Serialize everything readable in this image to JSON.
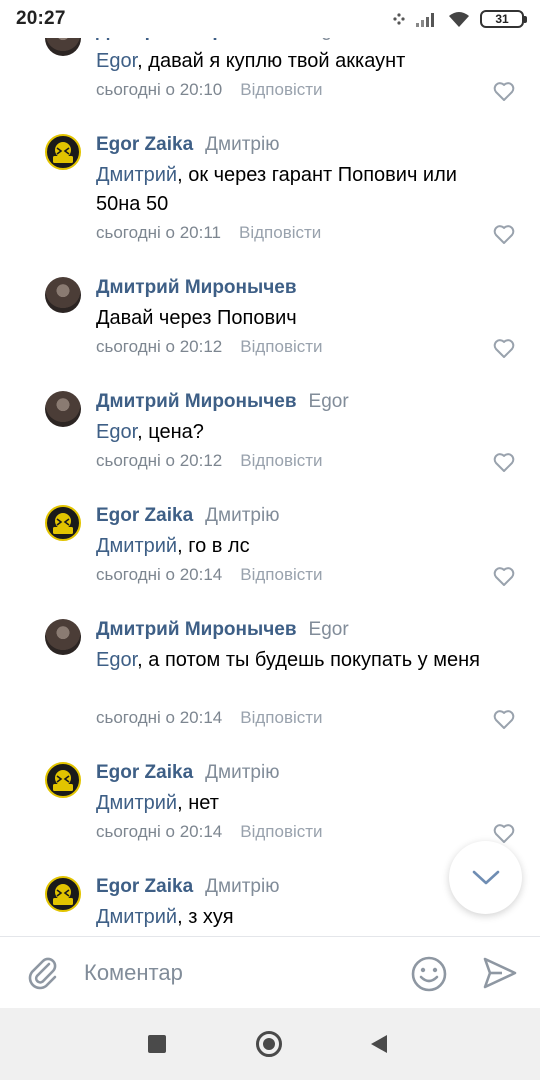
{
  "status_bar": {
    "time": "20:27",
    "battery": "31"
  },
  "reply_label": "Відповісти",
  "comments": [
    {
      "author": "Дмитрий Миронычев",
      "reply_to": "Egor",
      "mention": "Egor",
      "text": ", давай я куплю твой аккаунт",
      "time": "сьогодні о 20:10",
      "avatar": "person"
    },
    {
      "author": "Egor Zaika",
      "reply_to": "Дмитрію",
      "mention": "Дмитрий",
      "text": ", ок через гарант Попович или 50на 50",
      "time": "сьогодні о 20:11",
      "avatar": "burn"
    },
    {
      "author": "Дмитрий Миронычев",
      "reply_to": "",
      "mention": "",
      "text": "Давай через Попович",
      "time": "сьогодні о 20:12",
      "avatar": "person"
    },
    {
      "author": "Дмитрий Миронычев",
      "reply_to": "Egor",
      "mention": "Egor",
      "text": ", цена?",
      "time": "сьогодні о 20:12",
      "avatar": "person"
    },
    {
      "author": "Egor Zaika",
      "reply_to": "Дмитрію",
      "mention": "Дмитрий",
      "text": ", го в лс",
      "time": "сьогодні о 20:14",
      "avatar": "burn"
    },
    {
      "author": "Дмитрий Миронычев",
      "reply_to": "Egor",
      "mention": "Egor",
      "text": ", а потом ты будешь покупать у меня",
      "time": "сьогодні о 20:14",
      "avatar": "person"
    },
    {
      "author": "Egor Zaika",
      "reply_to": "Дмитрію",
      "mention": "Дмитрий",
      "text": ", нет",
      "time": "сьогодні о 20:14",
      "avatar": "burn"
    },
    {
      "author": "Egor Zaika",
      "reply_to": "Дмитрію",
      "mention": "Дмитрий",
      "text": ", з хуя",
      "time": "",
      "avatar": "burn"
    }
  ],
  "input": {
    "placeholder": "Коментар"
  },
  "icons": {
    "attach": "paperclip-icon",
    "emoji": "smiley-icon",
    "send": "send-arrow-icon",
    "scroll": "chevron-down-icon",
    "like": "heart-outline-icon",
    "burn_logo_text": "BURN"
  },
  "colors": {
    "link": "#3e5f86",
    "secondary": "#818c99",
    "nav_bg": "#f0f0f0"
  }
}
